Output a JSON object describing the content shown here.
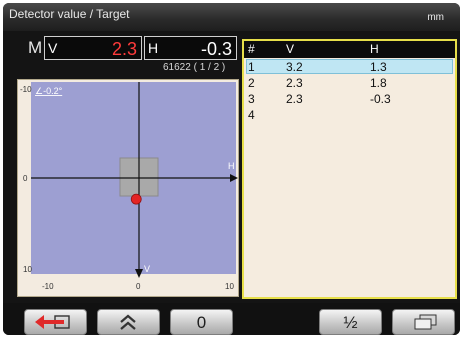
{
  "header": {
    "title": "Detector value / Target",
    "unit": "mm"
  },
  "readout": {
    "mode": "M",
    "v_label": "V",
    "v_value": "2.3",
    "h_label": "H",
    "h_value": "-0.3",
    "counter": "61622 ( 1 / 2 )"
  },
  "plot": {
    "angle": "∠-0.2°",
    "x_ticks": [
      "-10",
      "0",
      "10"
    ],
    "y_ticks": [
      "-10",
      "0",
      "10"
    ],
    "axis_h": "H",
    "axis_v": "V",
    "point": {
      "h": -0.3,
      "v": 2.3
    },
    "range": [
      -10,
      10
    ]
  },
  "table": {
    "headers": [
      "#",
      "V",
      "H"
    ],
    "rows": [
      [
        "1",
        "3.2",
        "1.3"
      ],
      [
        "2",
        "2.3",
        "1.8"
      ],
      [
        "3",
        "2.3",
        "-0.3"
      ],
      [
        "4",
        "",
        ""
      ]
    ],
    "selected_row": 0
  },
  "buttons": {
    "back_icon": "exit-arrow-icon",
    "up_icon": "double-chevron-up-icon",
    "zero": "0",
    "half": "½",
    "copy_icon": "stacked-windows-icon"
  },
  "colors": {
    "accent": "#e7df4a",
    "value_red": "#ff3b3b",
    "plot_bg": "#9d9fd2",
    "point": "#e42424",
    "target": "#a9a9a9"
  }
}
